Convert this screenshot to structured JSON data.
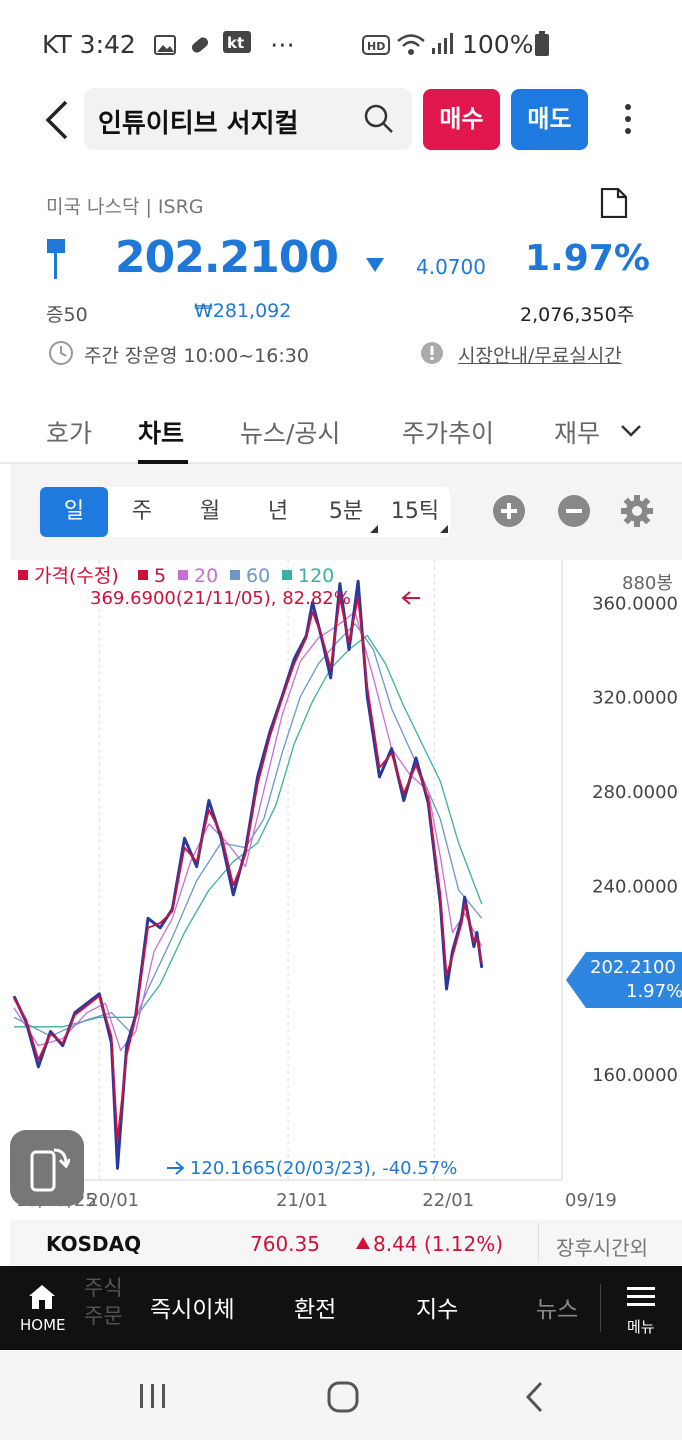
{
  "status_bar": {
    "carrier_time": "KT 3:42",
    "dots": "⋯",
    "battery": "100%",
    "icons": [
      "image-icon",
      "pill-icon",
      "kt-app-icon",
      "hd-icon",
      "wifi-icon",
      "signal-icon",
      "battery-icon"
    ]
  },
  "header": {
    "search_text": "인튜이티브 서지컬",
    "buy_label": "매수",
    "sell_label": "매도"
  },
  "stock": {
    "market": "미국 나스닥 | ISRG",
    "price": "202.2100",
    "change": "4.0700",
    "change_pct": "1.97%",
    "margin": "증50",
    "krw_price": "₩281,092",
    "volume": "2,076,350주",
    "hours": "주간 장운영 10:00~16:30",
    "info_link": "시장안내/무료실시간",
    "direction": "down",
    "color_down": "#1f78d8"
  },
  "tabs": [
    "호가",
    "차트",
    "뉴스/공시",
    "주가추이",
    "재무"
  ],
  "chart_toolbar": {
    "periods": [
      "일",
      "주",
      "월",
      "년",
      "5분",
      "15틱"
    ],
    "active": "일"
  },
  "chart_data": {
    "type": "line",
    "legend": [
      {
        "name": "가격(수정)",
        "color": "#d0103a"
      },
      {
        "name": "5",
        "color": "#d0103a"
      },
      {
        "name": "20",
        "color": "#c86fd6"
      },
      {
        "name": "60",
        "color": "#6b97c9"
      },
      {
        "name": "120",
        "color": "#3bb0a0"
      }
    ],
    "bar_count": "880봉",
    "y_ticks": [
      "360.0000",
      "320.0000",
      "280.0000",
      "240.0000",
      "160.0000"
    ],
    "y_tick_values": [
      360,
      320,
      280,
      240,
      160
    ],
    "ylim": [
      115,
      378
    ],
    "x_ticks": [
      "19/03/25",
      "20/01",
      "21/01",
      "22/01",
      "09/19"
    ],
    "x_tick_positions": [
      0,
      140,
      450,
      690,
      880
    ],
    "high_label": "369.6900(21/11/05), 82.82%",
    "low_label": "120.1665(20/03/23), -40.57%",
    "current_label": "202.2100",
    "current_pct": "1.97%",
    "price_series": [
      [
        0,
        193
      ],
      [
        20,
        182
      ],
      [
        40,
        163
      ],
      [
        60,
        178
      ],
      [
        80,
        172
      ],
      [
        100,
        186
      ],
      [
        120,
        190
      ],
      [
        140,
        194
      ],
      [
        160,
        173
      ],
      [
        170,
        120
      ],
      [
        185,
        172
      ],
      [
        200,
        185
      ],
      [
        220,
        226
      ],
      [
        240,
        222
      ],
      [
        260,
        230
      ],
      [
        280,
        260
      ],
      [
        300,
        248
      ],
      [
        320,
        276
      ],
      [
        340,
        260
      ],
      [
        360,
        236
      ],
      [
        380,
        255
      ],
      [
        400,
        286
      ],
      [
        420,
        305
      ],
      [
        440,
        320
      ],
      [
        460,
        336
      ],
      [
        480,
        346
      ],
      [
        490,
        360
      ],
      [
        505,
        345
      ],
      [
        520,
        328
      ],
      [
        535,
        368
      ],
      [
        550,
        340
      ],
      [
        565,
        369
      ],
      [
        580,
        320
      ],
      [
        600,
        286
      ],
      [
        620,
        298
      ],
      [
        640,
        276
      ],
      [
        660,
        294
      ],
      [
        680,
        275
      ],
      [
        700,
        232
      ],
      [
        710,
        196
      ],
      [
        720,
        212
      ],
      [
        735,
        226
      ],
      [
        740,
        235
      ],
      [
        755,
        214
      ],
      [
        760,
        220
      ],
      [
        768,
        205
      ]
    ],
    "ma5": [
      [
        0,
        192
      ],
      [
        20,
        183
      ],
      [
        40,
        166
      ],
      [
        60,
        177
      ],
      [
        80,
        173
      ],
      [
        100,
        185
      ],
      [
        120,
        189
      ],
      [
        140,
        193
      ],
      [
        160,
        176
      ],
      [
        170,
        132
      ],
      [
        185,
        168
      ],
      [
        200,
        184
      ],
      [
        220,
        222
      ],
      [
        240,
        224
      ],
      [
        260,
        229
      ],
      [
        280,
        256
      ],
      [
        300,
        250
      ],
      [
        320,
        272
      ],
      [
        340,
        262
      ],
      [
        360,
        240
      ],
      [
        380,
        253
      ],
      [
        400,
        283
      ],
      [
        420,
        303
      ],
      [
        440,
        319
      ],
      [
        460,
        334
      ],
      [
        480,
        345
      ],
      [
        490,
        356
      ],
      [
        505,
        346
      ],
      [
        520,
        332
      ],
      [
        535,
        362
      ],
      [
        550,
        343
      ],
      [
        565,
        362
      ],
      [
        580,
        324
      ],
      [
        600,
        290
      ],
      [
        620,
        296
      ],
      [
        640,
        279
      ],
      [
        660,
        291
      ],
      [
        680,
        277
      ],
      [
        700,
        236
      ],
      [
        710,
        202
      ],
      [
        720,
        210
      ],
      [
        735,
        224
      ],
      [
        740,
        232
      ],
      [
        755,
        216
      ],
      [
        760,
        218
      ],
      [
        768,
        207
      ]
    ],
    "ma20": [
      [
        0,
        188
      ],
      [
        40,
        172
      ],
      [
        80,
        175
      ],
      [
        120,
        186
      ],
      [
        150,
        190
      ],
      [
        175,
        170
      ],
      [
        200,
        178
      ],
      [
        230,
        212
      ],
      [
        260,
        226
      ],
      [
        290,
        250
      ],
      [
        320,
        266
      ],
      [
        350,
        258
      ],
      [
        380,
        248
      ],
      [
        410,
        280
      ],
      [
        440,
        312
      ],
      [
        470,
        335
      ],
      [
        500,
        345
      ],
      [
        530,
        350
      ],
      [
        560,
        356
      ],
      [
        590,
        328
      ],
      [
        620,
        298
      ],
      [
        650,
        287
      ],
      [
        680,
        280
      ],
      [
        700,
        252
      ],
      [
        720,
        220
      ],
      [
        740,
        228
      ],
      [
        768,
        214
      ]
    ],
    "ma60": [
      [
        0,
        184
      ],
      [
        60,
        176
      ],
      [
        120,
        183
      ],
      [
        160,
        186
      ],
      [
        190,
        178
      ],
      [
        220,
        196
      ],
      [
        260,
        218
      ],
      [
        300,
        242
      ],
      [
        340,
        258
      ],
      [
        380,
        256
      ],
      [
        410,
        268
      ],
      [
        440,
        296
      ],
      [
        470,
        320
      ],
      [
        500,
        334
      ],
      [
        530,
        343
      ],
      [
        560,
        351
      ],
      [
        590,
        340
      ],
      [
        620,
        315
      ],
      [
        660,
        292
      ],
      [
        700,
        268
      ],
      [
        730,
        238
      ],
      [
        768,
        226
      ]
    ],
    "ma120": [
      [
        0,
        180
      ],
      [
        80,
        180
      ],
      [
        140,
        184
      ],
      [
        200,
        184
      ],
      [
        240,
        198
      ],
      [
        280,
        220
      ],
      [
        320,
        238
      ],
      [
        360,
        250
      ],
      [
        400,
        258
      ],
      [
        430,
        274
      ],
      [
        460,
        300
      ],
      [
        490,
        318
      ],
      [
        520,
        332
      ],
      [
        550,
        340
      ],
      [
        580,
        346
      ],
      [
        610,
        334
      ],
      [
        640,
        316
      ],
      [
        670,
        300
      ],
      [
        700,
        284
      ],
      [
        730,
        258
      ],
      [
        768,
        232
      ]
    ]
  },
  "ticker": {
    "name": "KOSDAQ",
    "value": "760.35",
    "change": "8.44 (1.12%)",
    "extra": "장후시간외"
  },
  "bottom_nav": {
    "home": "HOME",
    "partial": "주식\n주문",
    "items": [
      "즉시이체",
      "환전",
      "지수",
      "뉴스"
    ],
    "menu": "메뉴"
  }
}
